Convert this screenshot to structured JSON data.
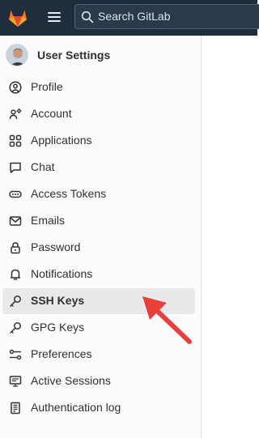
{
  "search": {
    "placeholder": "Search GitLab"
  },
  "sidebar": {
    "context_title": "User Settings",
    "items": [
      {
        "label": "Profile",
        "icon": "profile-icon"
      },
      {
        "label": "Account",
        "icon": "account-icon"
      },
      {
        "label": "Applications",
        "icon": "applications-icon"
      },
      {
        "label": "Chat",
        "icon": "chat-icon"
      },
      {
        "label": "Access Tokens",
        "icon": "token-icon"
      },
      {
        "label": "Emails",
        "icon": "mail-icon"
      },
      {
        "label": "Password",
        "icon": "lock-icon"
      },
      {
        "label": "Notifications",
        "icon": "bell-icon"
      },
      {
        "label": "SSH Keys",
        "icon": "key-icon",
        "active": true
      },
      {
        "label": "GPG Keys",
        "icon": "key-icon"
      },
      {
        "label": "Preferences",
        "icon": "preferences-icon"
      },
      {
        "label": "Active Sessions",
        "icon": "monitor-icon"
      },
      {
        "label": "Authentication log",
        "icon": "log-icon"
      }
    ]
  },
  "colors": {
    "topbar": "#1f2d3d",
    "annotation_arrow": "#e8413c",
    "logo": "#e24329"
  }
}
